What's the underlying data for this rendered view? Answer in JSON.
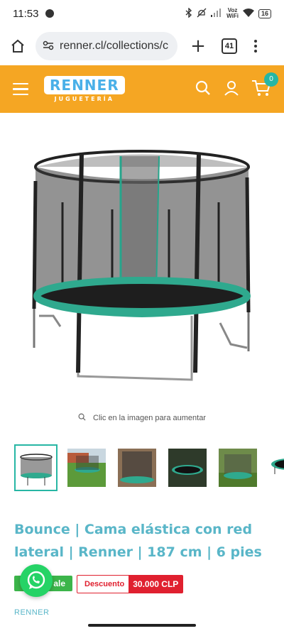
{
  "status_bar": {
    "time": "11:53",
    "voz_line1": "Voz",
    "voz_line2": "WiFi",
    "battery": "16"
  },
  "browser": {
    "url": "renner.cl/collections/c",
    "tab_count": "41"
  },
  "store": {
    "logo_text": "RENNER",
    "logo_sub": "JUGUETERÍA",
    "cart_count": "0",
    "brand_color": "#f5a623",
    "accent_color": "#27b6a4"
  },
  "product": {
    "zoom_hint": "Clic en la imagen para aumentar",
    "title": "Bounce | Cama elástica con red lateral | Renner | 187 cm | 6 pies",
    "sale_label": "ale",
    "discount_label": "Descuento",
    "discount_value": "30.000 CLP",
    "vendor": "RENNER",
    "thumbnail_count": 6
  }
}
